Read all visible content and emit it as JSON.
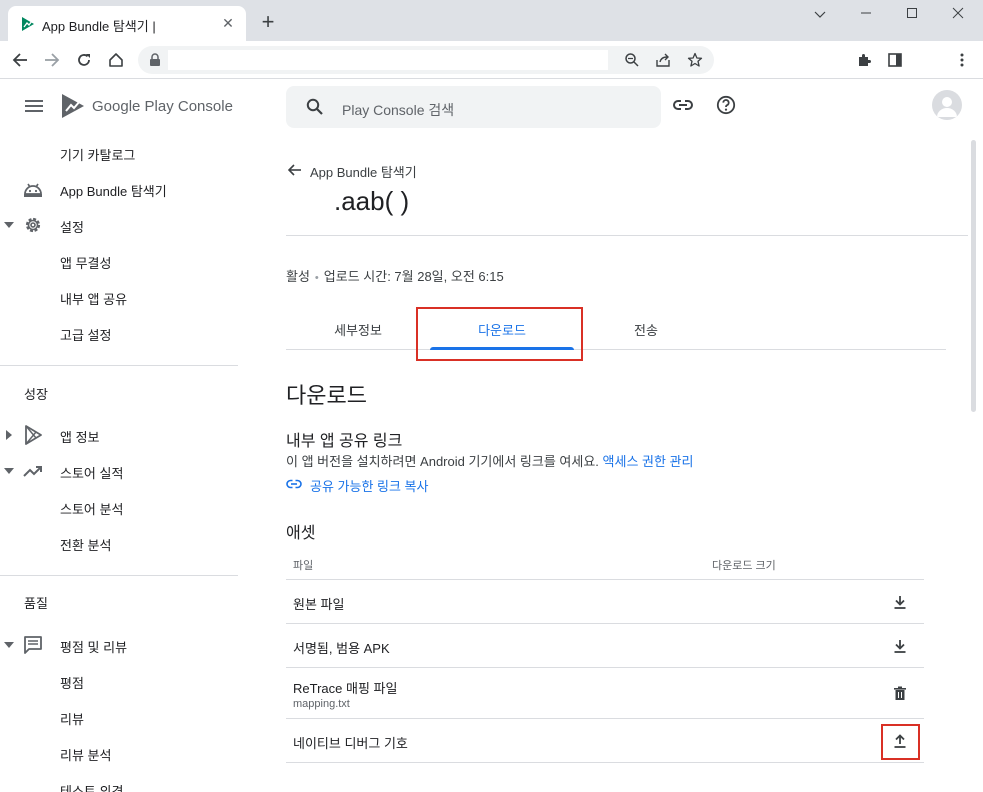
{
  "browser": {
    "tab_title": "App Bundle 탐색기 |",
    "tab_close": "✕",
    "new_tab": "+"
  },
  "sidebar": {
    "brand": "Google Play Console",
    "items": [
      {
        "label": "기기 카탈로그"
      },
      {
        "label": "App Bundle 탐색기"
      },
      {
        "label": "설정"
      },
      {
        "label": "앱 무결성"
      },
      {
        "label": "내부 앱 공유"
      },
      {
        "label": "고급 설정"
      }
    ],
    "section_growth": "성장",
    "growth_items": [
      {
        "label": "앱 정보"
      },
      {
        "label": "스토어 실적"
      },
      {
        "label": "스토어 분석"
      },
      {
        "label": "전환 분석"
      }
    ],
    "section_quality": "품질",
    "quality_items": [
      {
        "label": "평점 및 리뷰"
      },
      {
        "label": "평점"
      },
      {
        "label": "리뷰"
      },
      {
        "label": "리뷰 분석"
      },
      {
        "label": "테스트 의견"
      }
    ]
  },
  "header": {
    "search_placeholder": "Play Console 검색"
  },
  "main": {
    "back_label": "App Bundle 탐색기",
    "title": ".aab(        )",
    "status": "활성",
    "status_sep": "•",
    "upload_time": "업로드 시간: 7월 28일, 오전 6:15",
    "tabs": [
      {
        "label": "세부정보"
      },
      {
        "label": "다운로드"
      },
      {
        "label": "전송"
      }
    ],
    "download_heading": "다운로드",
    "share_heading": "내부 앱 공유 링크",
    "share_desc": "이 앱 버전을 설치하려면 Android 기기에서 링크를 여세요.",
    "share_manage_link": "액세스 권한 관리",
    "copy_link": "공유 가능한 링크 복사",
    "assets_heading": "애셋",
    "table": {
      "col_file": "파일",
      "col_size": "다운로드 크기",
      "rows": [
        {
          "name": "원본 파일",
          "sub": ""
        },
        {
          "name": "서명됨, 범용 APK",
          "sub": ""
        },
        {
          "name": "ReTrace 매핑 파일",
          "sub": "mapping.txt"
        },
        {
          "name": "네이티브 디버그 기호",
          "sub": ""
        }
      ]
    }
  },
  "colors": {
    "accent": "#1a73e8",
    "highlight": "#d93025"
  }
}
